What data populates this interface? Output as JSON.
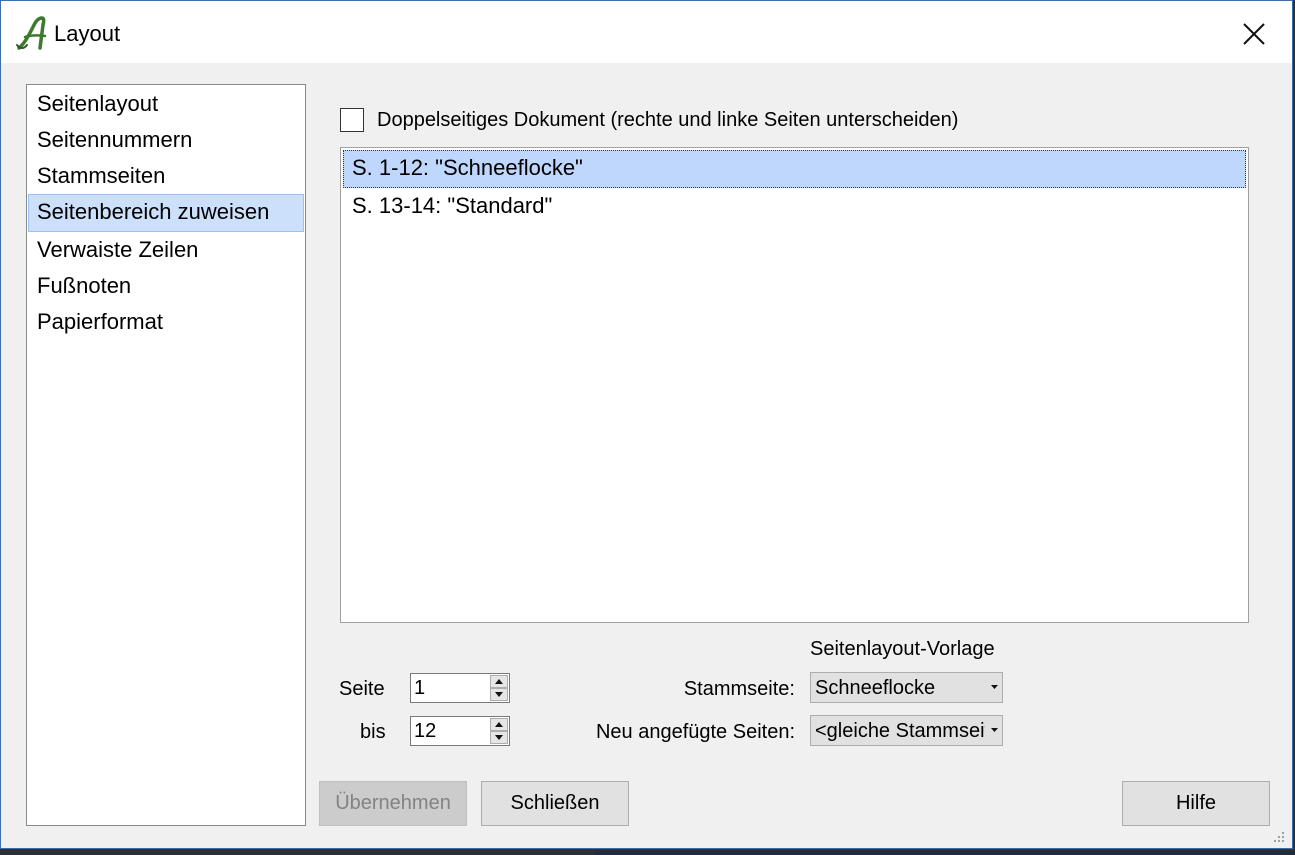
{
  "window": {
    "title": "Layout"
  },
  "nav": {
    "items": [
      {
        "label": "Seitenlayout"
      },
      {
        "label": "Seitennummern"
      },
      {
        "label": "Stammseiten"
      },
      {
        "label": "Seitenbereich zuweisen",
        "selected": true
      },
      {
        "label": "Verwaiste Zeilen"
      },
      {
        "label": "Fußnoten"
      },
      {
        "label": "Papierformat"
      }
    ]
  },
  "doublesided": {
    "label": "Doppelseitiges Dokument (rechte und linke Seiten unterscheiden)",
    "checked": false
  },
  "ranges": {
    "rows": [
      {
        "label": "S. 1-12: \"Schneeflocke\"",
        "selected": true
      },
      {
        "label": "S. 13-14: \"Standard\""
      }
    ]
  },
  "pagerange": {
    "from_label": "Seite",
    "from_value": "1",
    "to_label": "bis",
    "to_value": "12"
  },
  "template": {
    "group_label": "Seitenlayout-Vorlage",
    "master_label": "Stammseite:",
    "master_value": "Schneeflocke",
    "new_pages_label": "Neu angefügte Seiten:",
    "new_pages_value": "<gleiche Stammseite>"
  },
  "buttons": {
    "apply": "Übernehmen",
    "close": "Schließen",
    "help": "Hilfe"
  },
  "colors": {
    "selection": "#cce0fb",
    "list_selection": "#bfd7fd",
    "window_border": "#3c6ea8",
    "logo_green": "#3d7a2e"
  }
}
